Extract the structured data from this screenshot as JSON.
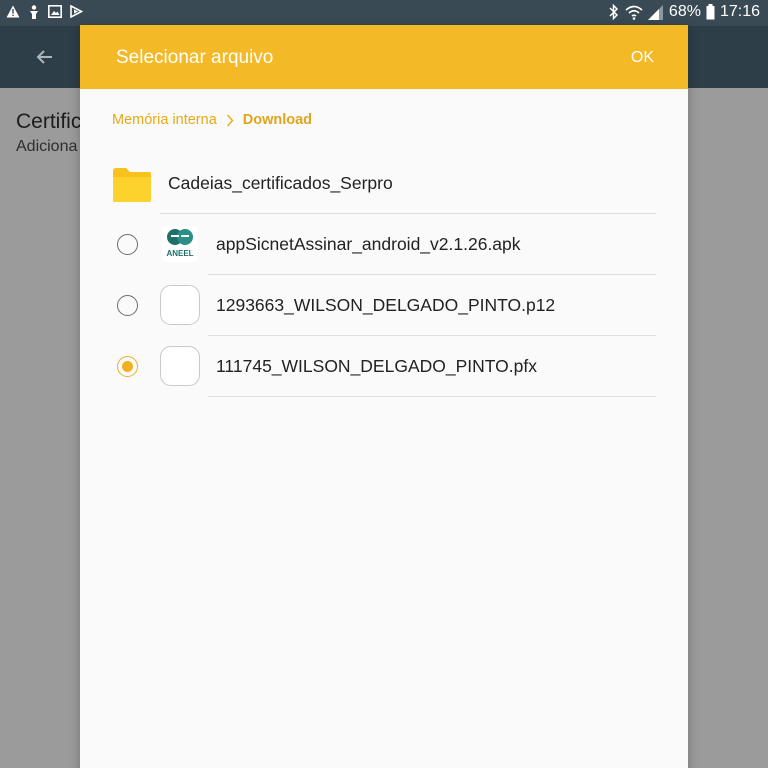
{
  "status_bar": {
    "battery_percent": "68%",
    "time": "17:16",
    "icons": [
      "warning-icon",
      "figure-icon",
      "image-icon",
      "play-icon",
      "bluetooth-icon",
      "wifi-icon",
      "signal-icon",
      "battery-icon"
    ]
  },
  "background_app": {
    "title": "Certific",
    "subtitle": "Adiciona"
  },
  "dialog": {
    "title": "Selecionar arquivo",
    "ok_label": "OK",
    "breadcrumb": [
      "Memória interna",
      "Download"
    ],
    "folder": {
      "name": "Cadeias_certificados_Serpro"
    },
    "files": [
      {
        "name": "appSicnetAssinar_android_v2.1.26.apk",
        "icon": "aneel-app-icon",
        "selected": false
      },
      {
        "name": "1293663_WILSON_DELGADO_PINTO.p12",
        "icon": "blank-file-icon",
        "selected": false
      },
      {
        "name": "111745_WILSON_DELGADO_PINTO.pfx",
        "icon": "blank-file-icon",
        "selected": true
      }
    ],
    "apk_icon_text": "ANEEL",
    "accent_color": "#f3b926"
  }
}
